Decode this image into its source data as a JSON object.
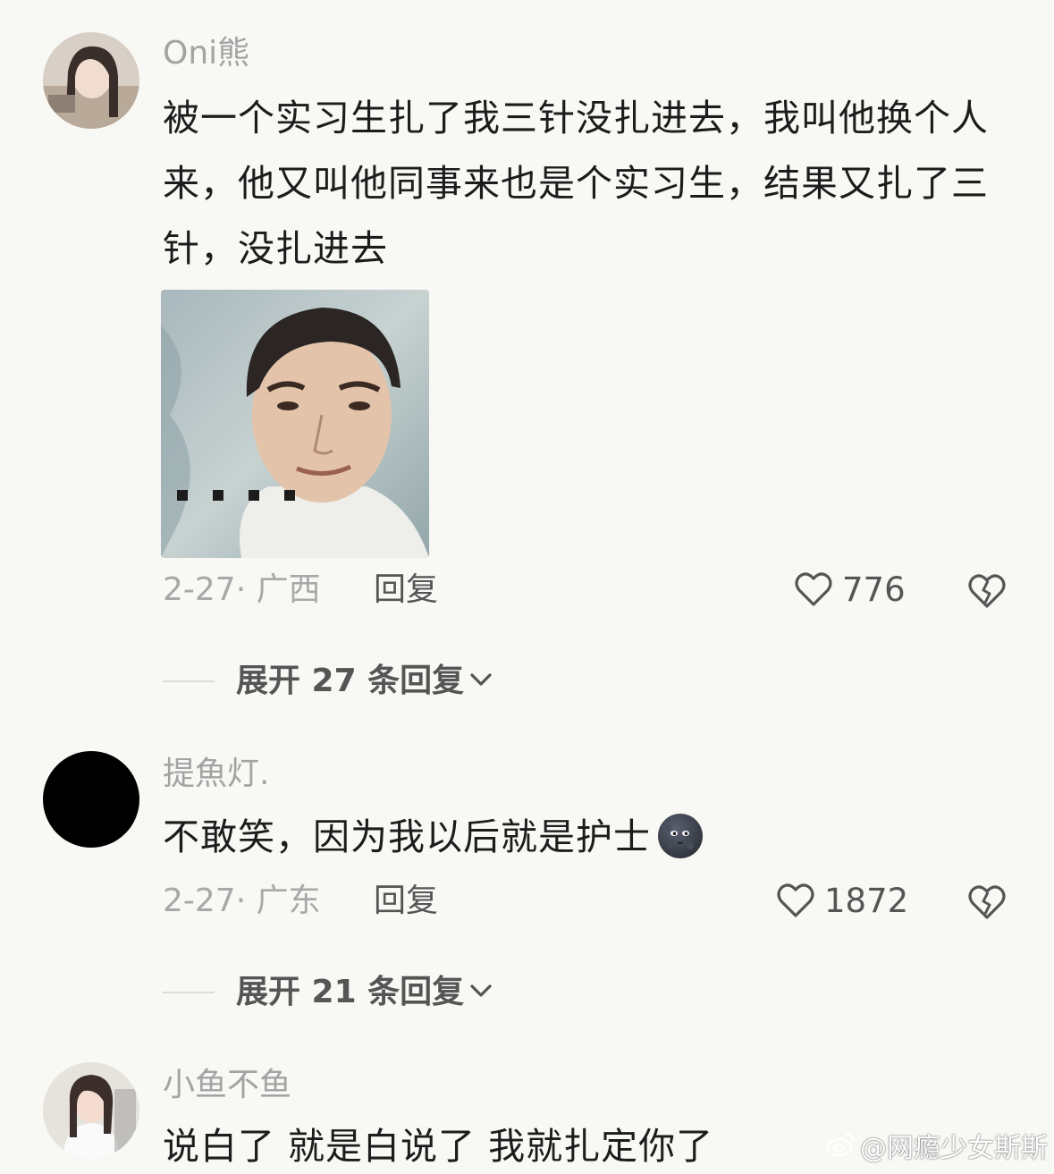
{
  "comments": [
    {
      "username": "Oni熊",
      "text": "被一个实习生扎了我三针没扎进去，我叫他换个人来，他又叫他同事来也是个实习生，结果又扎了三针，没扎进去",
      "date_location": "2-27· 广西",
      "reply_label": "回复",
      "like_count": "776",
      "expand_label": "展开 27 条回复"
    },
    {
      "username": "提魚灯.",
      "text": "不敢笑，因为我以后就是护士",
      "emoji": "new-moon-face",
      "date_location": "2-27· 广东",
      "reply_label": "回复",
      "like_count": "1872",
      "expand_label": "展开 21 条回复"
    },
    {
      "username": "小鱼不鱼",
      "text": "说白了 就是白说了 我就扎定你了"
    }
  ],
  "watermark": "@网瘾少女斯斯",
  "colors": {
    "background": "#f8f8f5",
    "username": "#a3a3a3",
    "text": "#1c1c1c",
    "meta": "#a8a8a8",
    "action": "#555555"
  }
}
